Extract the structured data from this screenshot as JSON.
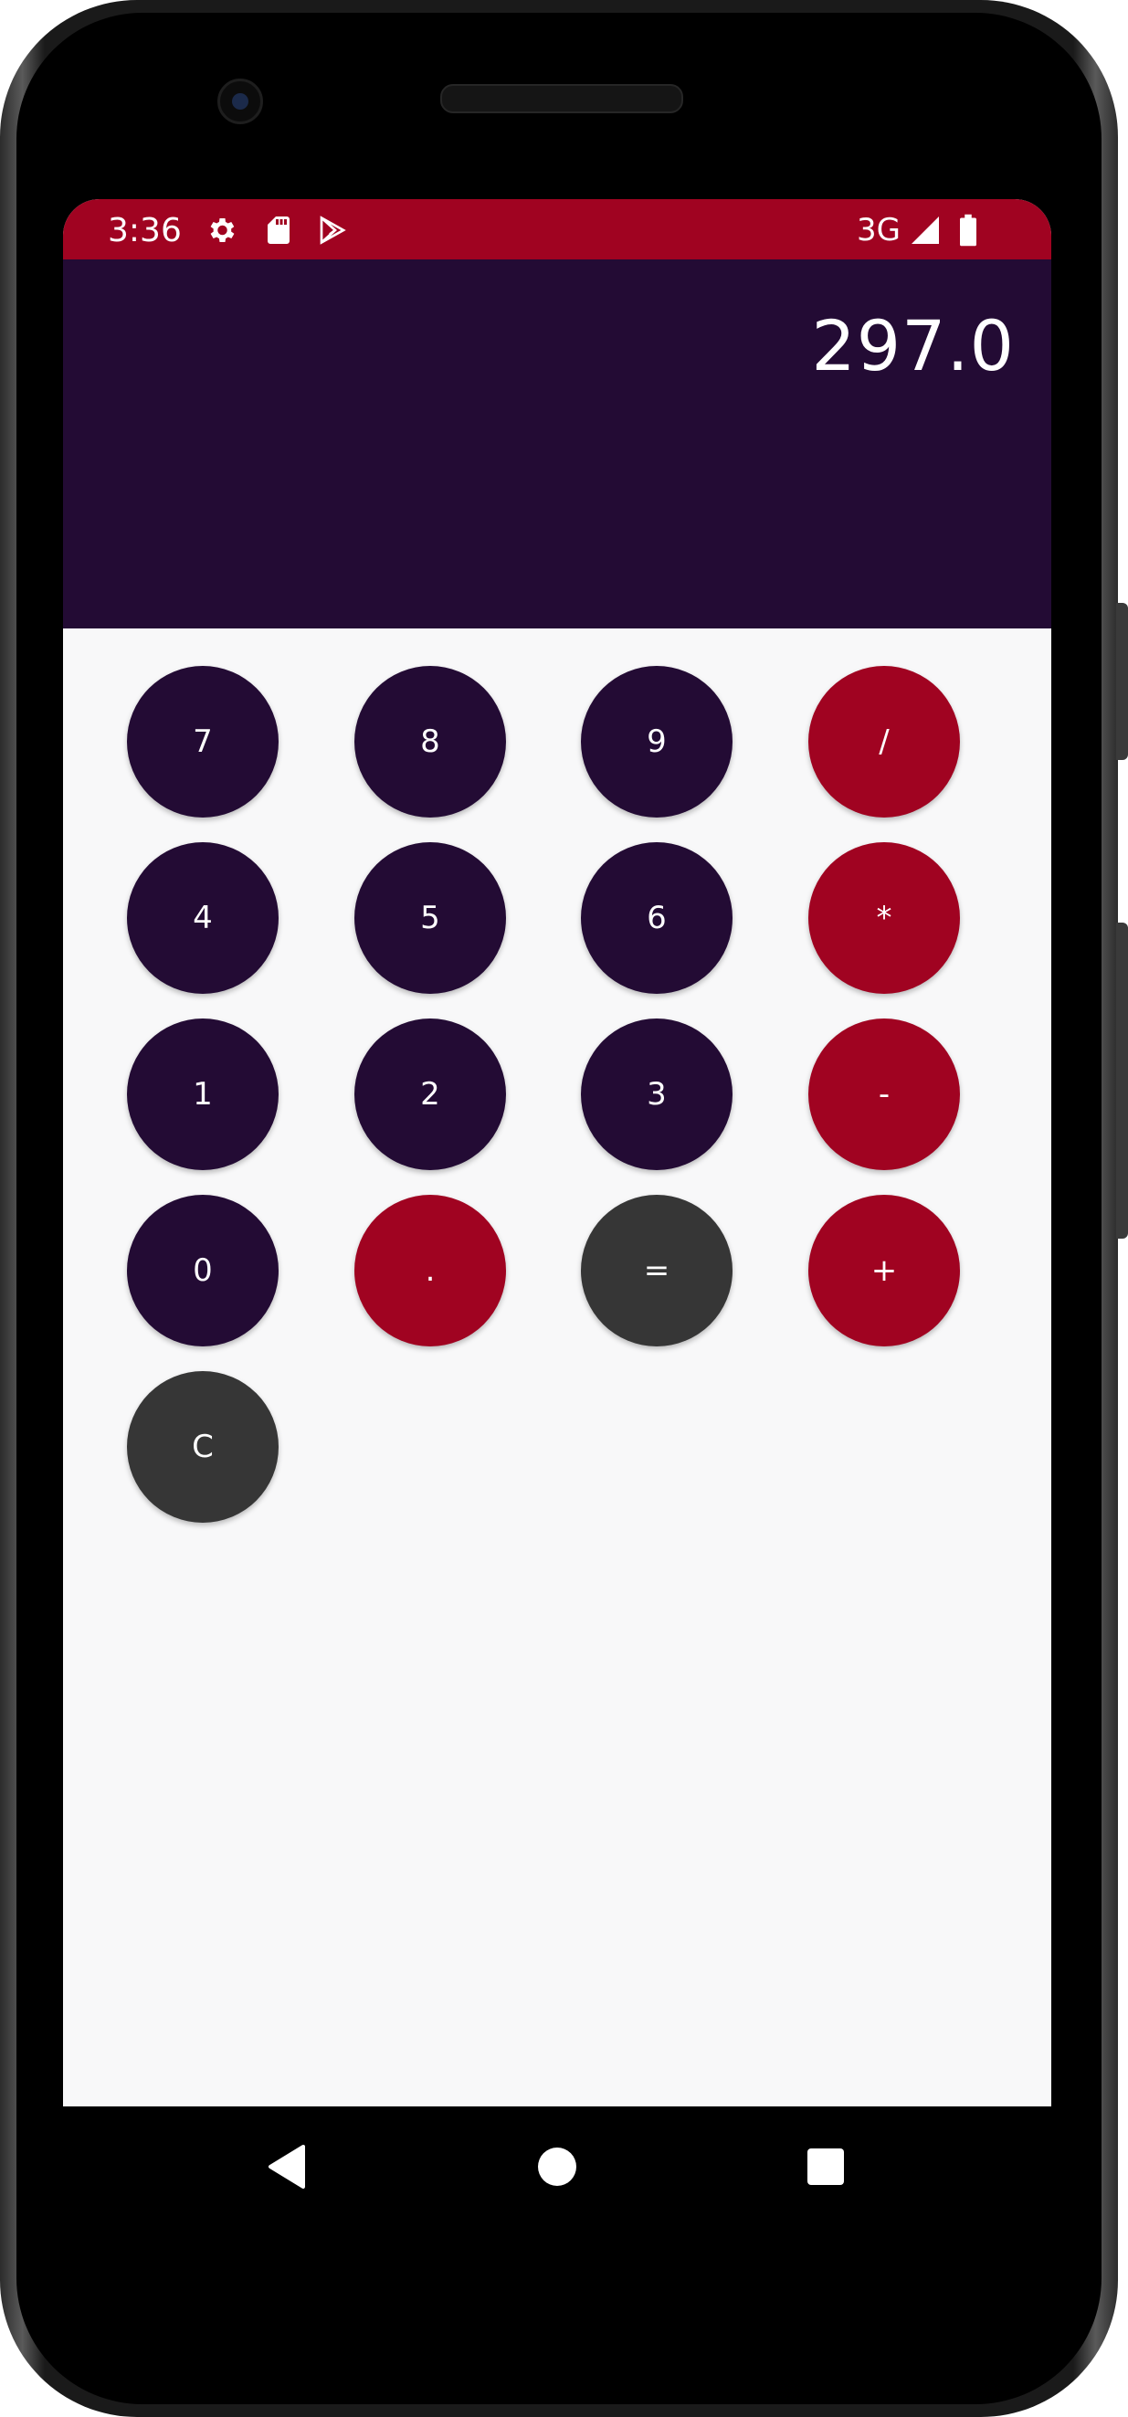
{
  "status_bar": {
    "time": "3:36",
    "network": "3G",
    "icons": [
      "settings-icon",
      "sd-card-icon",
      "play-store-icon",
      "signal-icon",
      "battery-icon"
    ]
  },
  "display": {
    "value": "297.0"
  },
  "colors": {
    "status_bar": "#a00321",
    "display_bg": "#230b34",
    "digit_key": "#230b34",
    "operator_key": "#a00321",
    "action_key": "#363636",
    "keypad_bg": "#f8f8f9"
  },
  "keys": [
    {
      "label": "7",
      "kind": "digit"
    },
    {
      "label": "8",
      "kind": "digit"
    },
    {
      "label": "9",
      "kind": "digit"
    },
    {
      "label": "/",
      "kind": "operator"
    },
    {
      "label": "4",
      "kind": "digit"
    },
    {
      "label": "5",
      "kind": "digit"
    },
    {
      "label": "6",
      "kind": "digit"
    },
    {
      "label": "*",
      "kind": "operator"
    },
    {
      "label": "1",
      "kind": "digit"
    },
    {
      "label": "2",
      "kind": "digit"
    },
    {
      "label": "3",
      "kind": "digit"
    },
    {
      "label": "-",
      "kind": "operator"
    },
    {
      "label": "0",
      "kind": "digit"
    },
    {
      "label": ".",
      "kind": "operator"
    },
    {
      "label": "=",
      "kind": "action"
    },
    {
      "label": "+",
      "kind": "operator"
    },
    {
      "label": "C",
      "kind": "action"
    }
  ],
  "nav": {
    "icons": [
      "back-icon",
      "home-icon",
      "recents-icon"
    ]
  }
}
